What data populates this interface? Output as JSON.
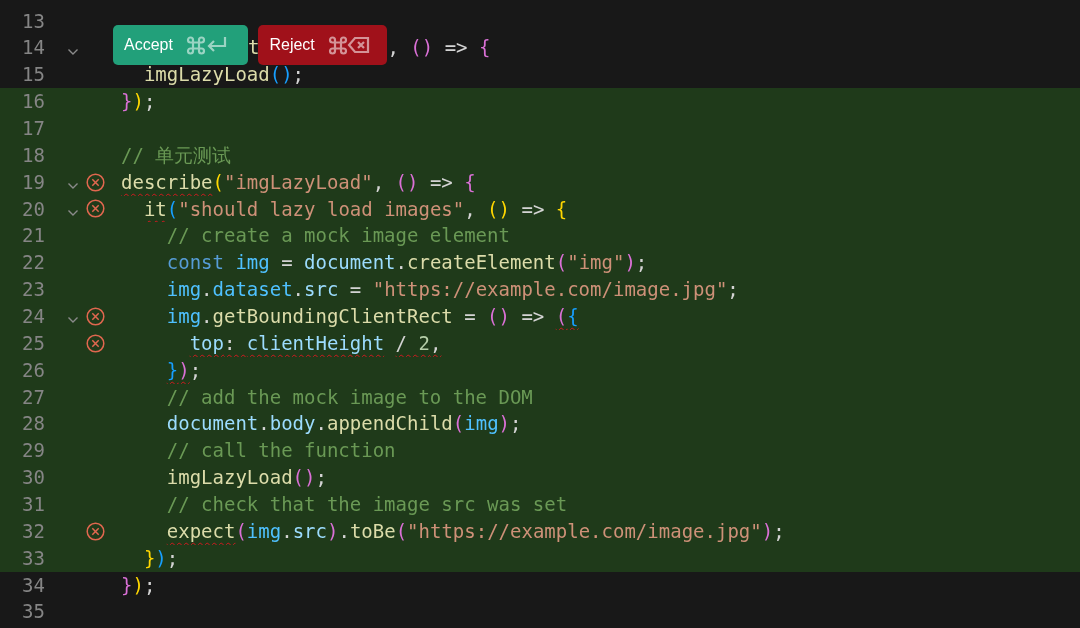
{
  "editor": {
    "lines": [
      {
        "number": "13",
        "fold": false,
        "error": false,
        "added": false
      },
      {
        "number": "14",
        "fold": true,
        "error": false,
        "added": false,
        "tokens": [
          {
            "kind": "accept_button",
            "text": "Accept"
          },
          {
            "kind": "function",
            "text": "t"
          },
          {
            "kind": "reject_button",
            "text": "Reject"
          },
          {
            "kind": "punct",
            "text": ", "
          },
          {
            "kind": "bracket_purple",
            "text": "()"
          },
          {
            "kind": "punct",
            "text": " => "
          },
          {
            "kind": "bracket_purple",
            "text": "{"
          }
        ]
      },
      {
        "number": "15",
        "fold": false,
        "error": false,
        "added": false,
        "tokens": [
          {
            "kind": "function",
            "text": "  imgLazyLoad"
          },
          {
            "kind": "bracket_blue",
            "text": "()"
          },
          {
            "kind": "punct",
            "text": ";"
          }
        ]
      },
      {
        "number": "16",
        "fold": false,
        "error": false,
        "added": true,
        "tokens": [
          {
            "kind": "bracket_purple",
            "text": "}"
          },
          {
            "kind": "bracket_gold",
            "text": ")"
          },
          {
            "kind": "punct",
            "text": ";"
          }
        ]
      },
      {
        "number": "17",
        "fold": false,
        "error": false,
        "added": true
      },
      {
        "number": "18",
        "fold": false,
        "error": false,
        "added": true,
        "tokens": [
          {
            "kind": "comment",
            "text": "// 单元测试"
          }
        ]
      },
      {
        "number": "19",
        "fold": true,
        "error": true,
        "added": true,
        "tokens": [
          {
            "kind": "function",
            "text": "describe",
            "squiggle": true
          },
          {
            "kind": "bracket_gold",
            "text": "("
          },
          {
            "kind": "string",
            "text": "\"imgLazyLoad\""
          },
          {
            "kind": "punct",
            "text": ", "
          },
          {
            "kind": "bracket_purple",
            "text": "()"
          },
          {
            "kind": "punct",
            "text": " => "
          },
          {
            "kind": "bracket_purple",
            "text": "{"
          }
        ]
      },
      {
        "number": "20",
        "fold": true,
        "error": true,
        "added": true,
        "tokens": [
          {
            "kind": "function",
            "text": "  it",
            "squiggle": true
          },
          {
            "kind": "bracket_blue",
            "text": "("
          },
          {
            "kind": "string",
            "text": "\"should lazy load images\""
          },
          {
            "kind": "punct",
            "text": ", "
          },
          {
            "kind": "bracket_gold",
            "text": "()"
          },
          {
            "kind": "punct",
            "text": " => "
          },
          {
            "kind": "bracket_gold",
            "text": "{"
          }
        ]
      },
      {
        "number": "21",
        "fold": false,
        "error": false,
        "added": true,
        "tokens": [
          {
            "kind": "comment",
            "text": "    // create a mock image element"
          }
        ]
      },
      {
        "number": "22",
        "fold": false,
        "error": false,
        "added": true,
        "tokens": [
          {
            "kind": "keyword",
            "text": "    const "
          },
          {
            "kind": "constant",
            "text": "img"
          },
          {
            "kind": "punct",
            "text": " = "
          },
          {
            "kind": "variable",
            "text": "document"
          },
          {
            "kind": "punct",
            "text": "."
          },
          {
            "kind": "function",
            "text": "createElement"
          },
          {
            "kind": "bracket_purple",
            "text": "("
          },
          {
            "kind": "string",
            "text": "\"img\""
          },
          {
            "kind": "bracket_purple",
            "text": ")"
          },
          {
            "kind": "punct",
            "text": ";"
          }
        ]
      },
      {
        "number": "23",
        "fold": false,
        "error": false,
        "added": true,
        "tokens": [
          {
            "kind": "constant",
            "text": "    img"
          },
          {
            "kind": "punct",
            "text": "."
          },
          {
            "kind": "constant",
            "text": "dataset"
          },
          {
            "kind": "punct",
            "text": "."
          },
          {
            "kind": "variable",
            "text": "src"
          },
          {
            "kind": "punct",
            "text": " = "
          },
          {
            "kind": "string",
            "text": "\"https://example.com/image.jpg\""
          },
          {
            "kind": "punct",
            "text": ";"
          }
        ]
      },
      {
        "number": "24",
        "fold": true,
        "error": true,
        "added": true,
        "tokens": [
          {
            "kind": "constant",
            "text": "    img"
          },
          {
            "kind": "punct",
            "text": "."
          },
          {
            "kind": "function",
            "text": "getBoundingClientRect"
          },
          {
            "kind": "punct",
            "text": " = "
          },
          {
            "kind": "bracket_purple",
            "text": "()"
          },
          {
            "kind": "punct",
            "text": " => "
          },
          {
            "kind": "bracket_purple",
            "text": "(",
            "squiggle": true
          },
          {
            "kind": "bracket_blue",
            "text": "{",
            "squiggle": true
          }
        ]
      },
      {
        "number": "25",
        "fold": false,
        "error": true,
        "added": true,
        "tokens": [
          {
            "kind": "variable",
            "text": "      top",
            "squiggle": true
          },
          {
            "kind": "punct",
            "text": ": ",
            "squiggle": true
          },
          {
            "kind": "variable",
            "text": "clientHeight",
            "squiggle": true
          },
          {
            "kind": "punct",
            "text": " / ",
            "squiggle": true
          },
          {
            "kind": "number",
            "text": "2",
            "squiggle": true
          },
          {
            "kind": "punct",
            "text": ",",
            "squiggle": true
          }
        ]
      },
      {
        "number": "26",
        "fold": false,
        "error": false,
        "added": true,
        "tokens": [
          {
            "kind": "bracket_blue",
            "text": "    }",
            "squiggle": true
          },
          {
            "kind": "bracket_purple",
            "text": ")",
            "squiggle": true
          },
          {
            "kind": "punct",
            "text": ";"
          }
        ]
      },
      {
        "number": "27",
        "fold": false,
        "error": false,
        "added": true,
        "tokens": [
          {
            "kind": "comment",
            "text": "    // add the mock image to the DOM"
          }
        ]
      },
      {
        "number": "28",
        "fold": false,
        "error": false,
        "added": true,
        "tokens": [
          {
            "kind": "variable",
            "text": "    document"
          },
          {
            "kind": "punct",
            "text": "."
          },
          {
            "kind": "variable",
            "text": "body"
          },
          {
            "kind": "punct",
            "text": "."
          },
          {
            "kind": "function",
            "text": "appendChild"
          },
          {
            "kind": "bracket_purple",
            "text": "("
          },
          {
            "kind": "constant",
            "text": "img"
          },
          {
            "kind": "bracket_purple",
            "text": ")"
          },
          {
            "kind": "punct",
            "text": ";"
          }
        ]
      },
      {
        "number": "29",
        "fold": false,
        "error": false,
        "added": true,
        "tokens": [
          {
            "kind": "comment",
            "text": "    // call the function"
          }
        ]
      },
      {
        "number": "30",
        "fold": false,
        "error": false,
        "added": true,
        "tokens": [
          {
            "kind": "function",
            "text": "    imgLazyLoad"
          },
          {
            "kind": "bracket_purple",
            "text": "()"
          },
          {
            "kind": "punct",
            "text": ";"
          }
        ]
      },
      {
        "number": "31",
        "fold": false,
        "error": false,
        "added": true,
        "tokens": [
          {
            "kind": "comment",
            "text": "    // check that the image src was set"
          }
        ]
      },
      {
        "number": "32",
        "fold": false,
        "error": true,
        "added": true,
        "tokens": [
          {
            "kind": "function",
            "text": "    expect",
            "squiggle": true
          },
          {
            "kind": "bracket_purple",
            "text": "("
          },
          {
            "kind": "constant",
            "text": "img"
          },
          {
            "kind": "punct",
            "text": "."
          },
          {
            "kind": "variable",
            "text": "src"
          },
          {
            "kind": "bracket_purple",
            "text": ")"
          },
          {
            "kind": "punct",
            "text": "."
          },
          {
            "kind": "function",
            "text": "toBe"
          },
          {
            "kind": "bracket_purple",
            "text": "("
          },
          {
            "kind": "string",
            "text": "\"https://example.com/image.jpg\""
          },
          {
            "kind": "bracket_purple",
            "text": ")"
          },
          {
            "kind": "punct",
            "text": ";"
          }
        ]
      },
      {
        "number": "33",
        "fold": false,
        "error": false,
        "added": true,
        "tokens": [
          {
            "kind": "bracket_gold",
            "text": "  }"
          },
          {
            "kind": "bracket_blue",
            "text": ")"
          },
          {
            "kind": "punct",
            "text": ";"
          }
        ]
      },
      {
        "number": "34",
        "fold": false,
        "error": false,
        "added": false,
        "tokens": [
          {
            "kind": "bracket_purple",
            "text": "}"
          },
          {
            "kind": "bracket_gold",
            "text": ")"
          },
          {
            "kind": "punct",
            "text": ";"
          }
        ]
      },
      {
        "number": "35",
        "fold": false,
        "error": false,
        "added": false
      }
    ]
  }
}
